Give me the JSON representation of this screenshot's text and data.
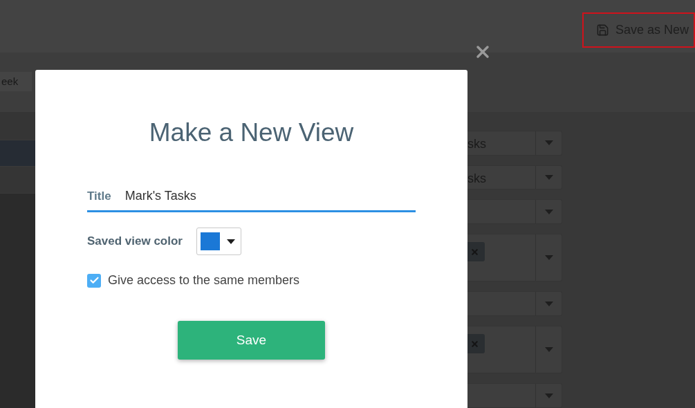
{
  "toolbar": {
    "save_as_new": "Save as New",
    "highlighted": true
  },
  "tabs": [
    {
      "label": "eek"
    }
  ],
  "sidebar": {
    "rows": [
      {
        "selected": false
      },
      {
        "selected": true
      },
      {
        "selected": false
      }
    ]
  },
  "filters": [
    {
      "kind": "select",
      "value": "sks"
    },
    {
      "kind": "select",
      "value": "sks"
    },
    {
      "kind": "select"
    },
    {
      "kind": "multi"
    },
    {
      "kind": "select"
    },
    {
      "kind": "multi"
    },
    {
      "kind": "select"
    }
  ],
  "modal": {
    "title": "Make a New View",
    "title_label": "Title",
    "title_value": "Mark's Tasks",
    "color_label": "Saved view color",
    "color": "#1b78d6",
    "access_label": "Give access to the same members",
    "access_checked": true,
    "save": "Save"
  }
}
